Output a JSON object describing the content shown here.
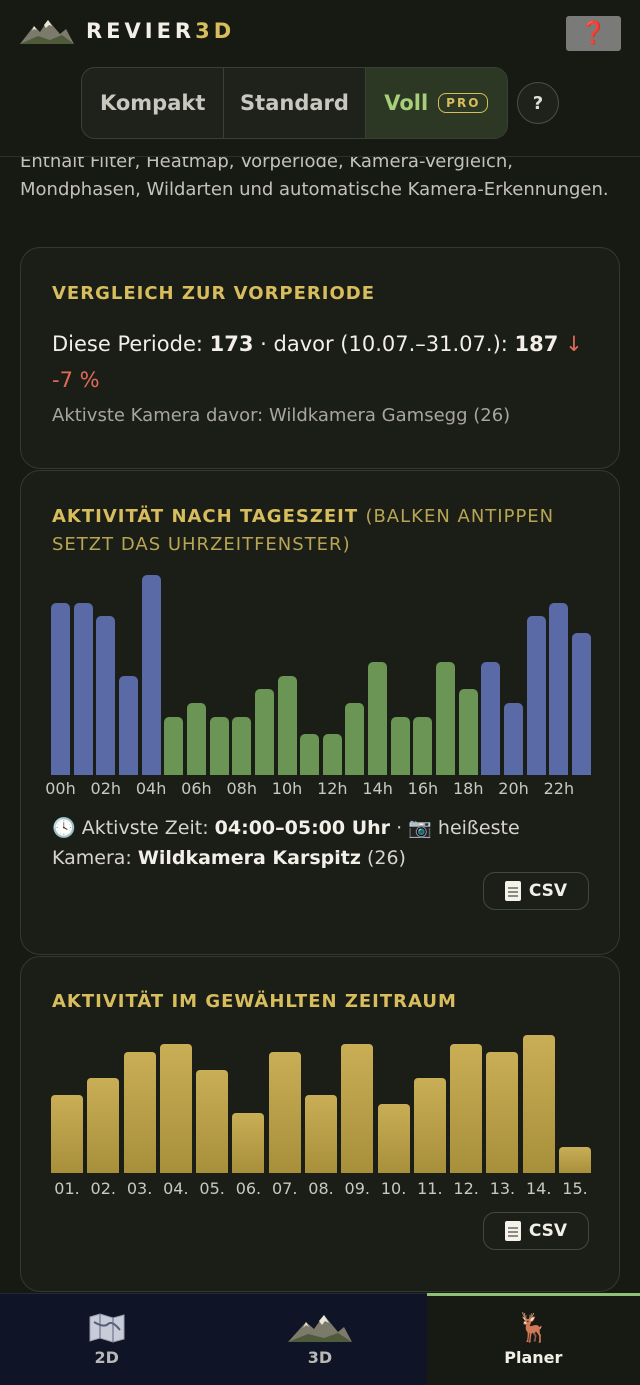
{
  "header": {
    "brand_main": "REVIER",
    "brand_accent": "3D",
    "help_glyph": "❓",
    "segments": [
      {
        "label": "Kompakt",
        "selected": false
      },
      {
        "label": "Standard",
        "selected": false
      },
      {
        "label": "Voll",
        "badge": "PRO",
        "selected": true
      }
    ],
    "help_button": "?"
  },
  "intro": {
    "text": "Enthält Filter, Heatmap, Vorperiode, Kamera-Vergleich, Mondphasen, Wildarten und automatische Kamera-Erkennungen."
  },
  "comparison": {
    "title": "VERGLEICH ZUR VORPERIODE",
    "label_this": "Diese Periode:",
    "value_this": "173",
    "label_before": "· davor (10.07.–31.07.):",
    "value_before": "187",
    "delta": "↓ -7 %",
    "most_active_before": "Aktivste Kamera davor: Wildkamera Gamsegg (26)"
  },
  "hourly": {
    "title": "AKTIVITÄT NACH TAGESZEIT",
    "subtitle": "(BALKEN ANTIPPEN SETZT DAS UHRZEITFENSTER)",
    "summary_clock": "🕓",
    "summary_label_time": "Aktivste Zeit:",
    "summary_time": "04:00–05:00 Uhr",
    "summary_sep": "·",
    "summary_camera_icon": "📷",
    "summary_label_camera": "heißeste Kamera:",
    "summary_camera": "Wildkamera Karspitz",
    "summary_camera_count": "(26)",
    "csv_label": "CSV"
  },
  "daily": {
    "title": "AKTIVITÄT IM GEWÄHLTEN ZEITRAUM",
    "csv_label": "CSV"
  },
  "chart_data": [
    {
      "type": "bar",
      "title": "AKTIVITÄT NACH TAGESZEIT",
      "categories": [
        "00h",
        "01h",
        "02h",
        "03h",
        "04h",
        "05h",
        "06h",
        "07h",
        "08h",
        "09h",
        "10h",
        "11h",
        "12h",
        "13h",
        "14h",
        "15h",
        "16h",
        "17h",
        "18h",
        "19h",
        "20h",
        "21h",
        "22h",
        "23h"
      ],
      "tick_labels": [
        "00h",
        "02h",
        "04h",
        "06h",
        "08h",
        "10h",
        "12h",
        "14h",
        "16h",
        "18h",
        "20h",
        "22h"
      ],
      "values": [
        12.5,
        12.5,
        11.5,
        7.2,
        14.5,
        4.2,
        5.2,
        4.2,
        4.2,
        6.2,
        7.2,
        3.0,
        3.0,
        5.2,
        8.2,
        4.2,
        4.2,
        8.2,
        6.2,
        8.2,
        5.2,
        11.5,
        12.5,
        10.3
      ],
      "colors": {
        "night": "#5a6aa6",
        "day": "#6a9555"
      },
      "day_hours": [
        5,
        19
      ],
      "ylim": [
        0,
        14.5
      ]
    },
    {
      "type": "bar",
      "title": "AKTIVITÄT IM GEWÄHLTEN ZEITRAUM",
      "categories": [
        "01.",
        "02.",
        "03.",
        "04.",
        "05.",
        "06.",
        "07.",
        "08.",
        "09.",
        "10.",
        "11.",
        "12.",
        "13.",
        "14.",
        "15."
      ],
      "values": [
        9,
        11,
        14,
        15,
        12,
        7,
        14,
        9,
        15,
        8,
        11,
        15,
        14,
        16,
        3
      ],
      "color": "#bca34b",
      "ylim": [
        0,
        16
      ]
    }
  ],
  "nav": {
    "items": [
      {
        "label": "2D",
        "icon": "map-icon",
        "active": false
      },
      {
        "label": "3D",
        "icon": "mountain-icon",
        "active": false
      },
      {
        "label": "Planer",
        "icon": "deer-icon",
        "active": true
      }
    ]
  }
}
